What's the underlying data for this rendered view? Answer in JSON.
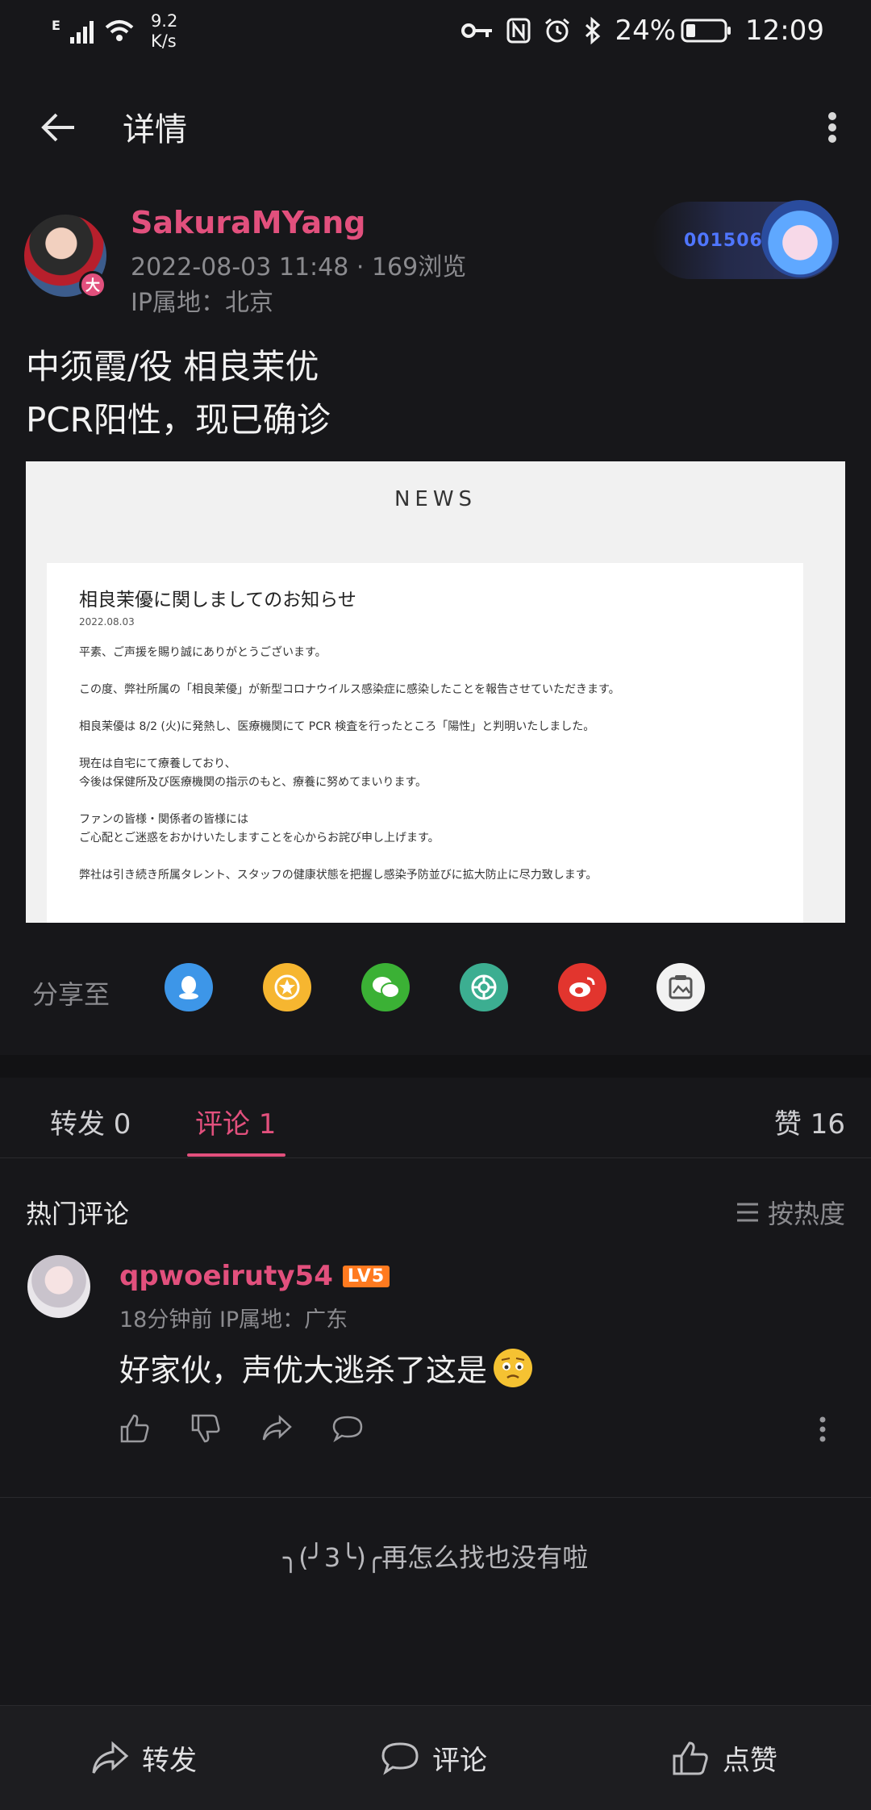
{
  "status_bar": {
    "net_type": "E",
    "net_speed_value": "9.2",
    "net_speed_unit": "K/s",
    "battery": "24%",
    "time": "12:09"
  },
  "nav": {
    "title": "详情"
  },
  "post": {
    "author": "SakuraMYang",
    "avatar_badge": "大",
    "meta": "2022-08-03 11:48 · 169浏览",
    "ip": "IP属地：北京",
    "decor_number": "001506",
    "text_line1": "中须霞/役 相良茉优",
    "text_line2": "PCR阳性，现已确诊"
  },
  "news": {
    "header": "NEWS",
    "title": "相良茉優に関しましてのお知らせ",
    "date": "2022.08.03",
    "p1": "平素、ご声援を賜り誠にありがとうございます。",
    "p2": "この度、弊社所属の「相良茉優」が新型コロナウイルス感染症に感染したことを報告させていただきます。",
    "p3": "相良茉優は 8/2 (火)に発熱し、医療機関にて PCR 検査を行ったところ「陽性」と判明いたしました。",
    "p4a": "現在は自宅にて療養しており、",
    "p4b": "今後は保健所及び医療機関の指示のもと、療養に努めてまいります。",
    "p5a": "ファンの皆様・関係者の皆様には",
    "p5b": "ご心配とご迷惑をおかけいたしますことを心からお詫び申し上げます。",
    "p6": "弊社は引き続き所属タレント、スタッフの健康状態を把握し感染予防並びに拡大防止に尽力致します。"
  },
  "share": {
    "label": "分享至",
    "icons": [
      "qq-icon",
      "qzone-icon",
      "wechat-icon",
      "moments-icon",
      "weibo-icon",
      "save-image-icon"
    ]
  },
  "tabs": {
    "repost": "转发 0",
    "comment": "评论 1",
    "like": "赞 16"
  },
  "comments": {
    "hot_title": "热门评论",
    "sort_label": "按热度",
    "items": [
      {
        "user": "qpwoeiruty54",
        "level": "LV5",
        "meta": "18分钟前  IP属地：广东",
        "text": "好家伙，声优大逃杀了这是"
      }
    ]
  },
  "end_text": "╮(╯3╰)╭再怎么找也没有啦",
  "bottom_bar": {
    "repost": "转发",
    "comment": "评论",
    "like": "点赞"
  },
  "colors": {
    "accent": "#e2507d",
    "background": "#17171a",
    "muted": "#8b8b8f"
  }
}
